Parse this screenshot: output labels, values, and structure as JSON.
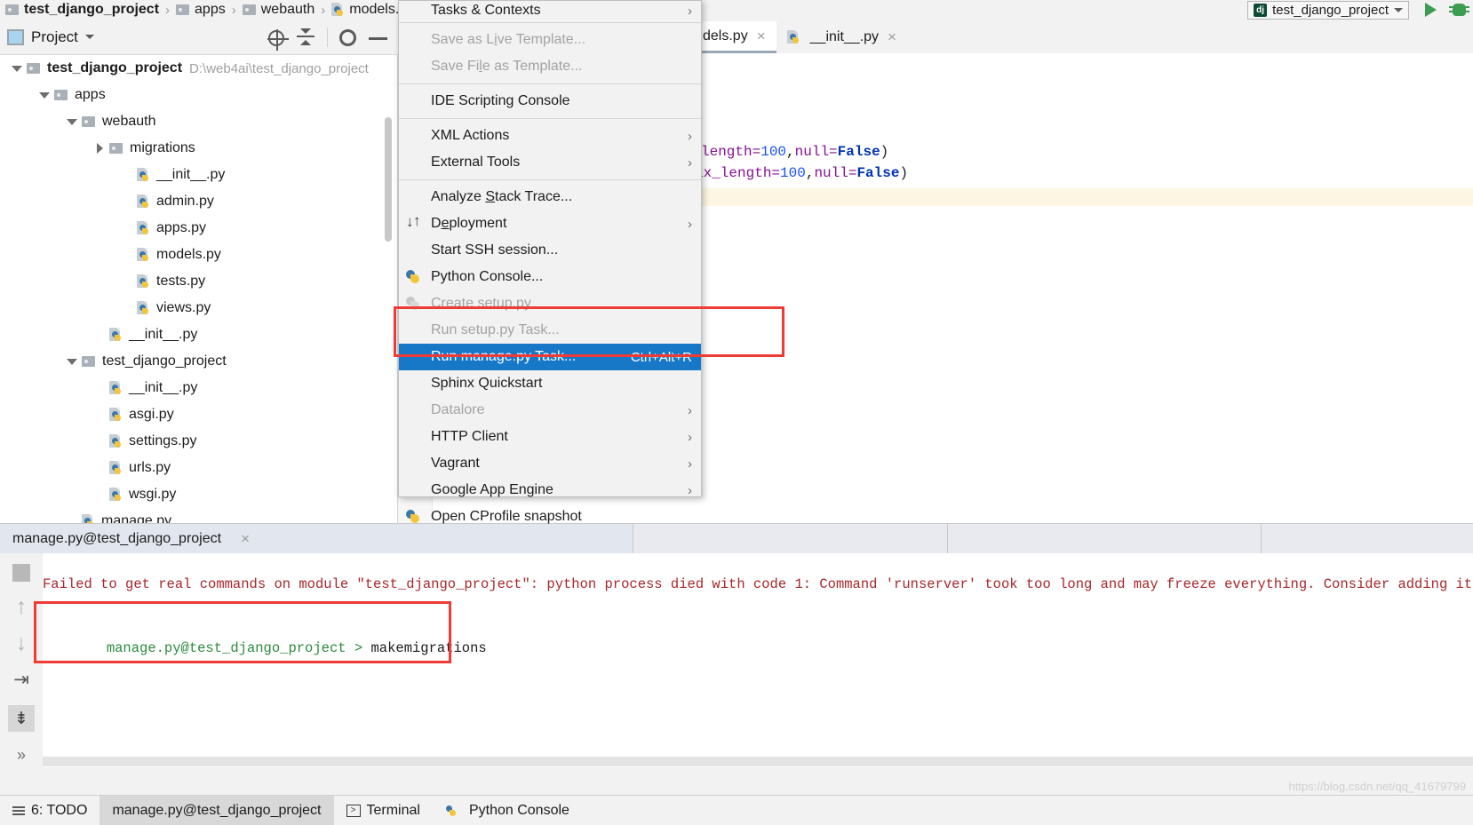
{
  "breadcrumb": {
    "items": [
      {
        "label": "test_django_project",
        "icon": "folder-icon",
        "bold": true
      },
      {
        "label": "apps",
        "icon": "folder-icon",
        "bold": false
      },
      {
        "label": "webauth",
        "icon": "folder-icon",
        "bold": false
      },
      {
        "label": "models.py",
        "icon": "python-file-icon",
        "bold": false
      }
    ],
    "separator": "›"
  },
  "run_config": {
    "name": "test_django_project",
    "icon": "django-icon",
    "badge": "dj",
    "chevron": "chevron-down-icon",
    "run_button": "run-icon",
    "debug_button": "debug-icon"
  },
  "project_panel": {
    "title": "Project",
    "chevron": "chevron-down-icon",
    "toolbar": [
      "locate-icon",
      "collapse-all-icon",
      "settings-gear-icon",
      "minimize-icon"
    ],
    "tree": [
      {
        "label": "test_django_project",
        "path": "D:\\web4ai\\test_django_project",
        "depth": 0,
        "arrow": "down",
        "icon": "folder-icon",
        "bold": true
      },
      {
        "label": "apps",
        "path": "",
        "depth": 1,
        "arrow": "down",
        "icon": "folder-icon",
        "bold": false
      },
      {
        "label": "webauth",
        "path": "",
        "depth": 2,
        "arrow": "down",
        "icon": "folder-icon",
        "bold": false
      },
      {
        "label": "migrations",
        "path": "",
        "depth": 3,
        "arrow": "right",
        "icon": "folder-icon",
        "bold": false
      },
      {
        "label": "__init__.py",
        "path": "",
        "depth": 4,
        "arrow": "none",
        "icon": "python-file-icon",
        "bold": false
      },
      {
        "label": "admin.py",
        "path": "",
        "depth": 4,
        "arrow": "none",
        "icon": "python-file-icon",
        "bold": false
      },
      {
        "label": "apps.py",
        "path": "",
        "depth": 4,
        "arrow": "none",
        "icon": "python-file-icon",
        "bold": false
      },
      {
        "label": "models.py",
        "path": "",
        "depth": 4,
        "arrow": "none",
        "icon": "python-file-icon",
        "bold": false
      },
      {
        "label": "tests.py",
        "path": "",
        "depth": 4,
        "arrow": "none",
        "icon": "python-file-icon",
        "bold": false
      },
      {
        "label": "views.py",
        "path": "",
        "depth": 4,
        "arrow": "none",
        "icon": "python-file-icon",
        "bold": false
      },
      {
        "label": "__init__.py",
        "path": "",
        "depth": 3,
        "arrow": "none",
        "icon": "python-file-icon",
        "bold": false
      },
      {
        "label": "test_django_project",
        "path": "",
        "depth": 2,
        "arrow": "down",
        "icon": "folder-icon",
        "bold": false
      },
      {
        "label": "__init__.py",
        "path": "",
        "depth": 3,
        "arrow": "none",
        "icon": "python-file-icon",
        "bold": false
      },
      {
        "label": "asgi.py",
        "path": "",
        "depth": 3,
        "arrow": "none",
        "icon": "python-file-icon",
        "bold": false
      },
      {
        "label": "settings.py",
        "path": "",
        "depth": 3,
        "arrow": "none",
        "icon": "python-file-icon",
        "bold": false
      },
      {
        "label": "urls.py",
        "path": "",
        "depth": 3,
        "arrow": "none",
        "icon": "python-file-icon",
        "bold": false
      },
      {
        "label": "wsgi.py",
        "path": "",
        "depth": 3,
        "arrow": "none",
        "icon": "python-file-icon",
        "bold": false
      },
      {
        "label": "manage.py",
        "path": "",
        "depth": 2,
        "arrow": "none",
        "icon": "python-file-icon",
        "bold": false
      }
    ]
  },
  "editor": {
    "tabs": [
      {
        "label": "dels.py",
        "icon": "python-file-icon",
        "active": true,
        "close": "×"
      },
      {
        "label": "__init__.py",
        "icon": "python-file-icon",
        "active": false,
        "close": "×"
      }
    ],
    "code": [
      {
        "parts": [
          {
            "text": "length=",
            "cls": "k-purple"
          },
          {
            "text": "100",
            "cls": "k-num"
          },
          {
            "text": ",",
            "cls": "k-plain"
          },
          {
            "text": "null=",
            "cls": "k-purple"
          },
          {
            "text": "False",
            "cls": "k-kw"
          },
          {
            "text": ")",
            "cls": "k-plain"
          }
        ]
      },
      {
        "parts": [
          {
            "text": "ax_length=",
            "cls": "k-purple"
          },
          {
            "text": "100",
            "cls": "k-num"
          },
          {
            "text": ",",
            "cls": "k-plain"
          },
          {
            "text": "null=",
            "cls": "k-purple"
          },
          {
            "text": "False",
            "cls": "k-kw"
          },
          {
            "text": ")",
            "cls": "k-plain"
          }
        ]
      }
    ]
  },
  "context_menu": {
    "items": [
      {
        "label": "Tasks & Contexts",
        "state": "normal",
        "submenu": true,
        "clipped": true,
        "icon": ""
      },
      {
        "sep": true
      },
      {
        "label": "Save as Live Template...",
        "state": "disabled",
        "accel": "i",
        "icon": ""
      },
      {
        "label": "Save File as Template...",
        "state": "disabled",
        "accel": "l",
        "icon": ""
      },
      {
        "sep": true
      },
      {
        "label": "IDE Scripting Console",
        "state": "normal",
        "icon": ""
      },
      {
        "sep": true
      },
      {
        "label": "XML Actions",
        "state": "normal",
        "submenu": true,
        "icon": ""
      },
      {
        "label": "External Tools",
        "state": "normal",
        "submenu": true,
        "icon": ""
      },
      {
        "sep": true
      },
      {
        "label": "Analyze Stack Trace...",
        "state": "normal",
        "accel": "S",
        "icon": ""
      },
      {
        "label": "Deployment",
        "state": "normal",
        "submenu": true,
        "accel": "e",
        "icon": "deployment-icon"
      },
      {
        "label": "Start SSH session...",
        "state": "normal",
        "icon": ""
      },
      {
        "label": "Python Console...",
        "state": "normal",
        "icon": "python-console-icon"
      },
      {
        "label": "Create setup.py",
        "state": "disabled",
        "icon": "python-file-icon-gray"
      },
      {
        "label": "Run setup.py Task...",
        "state": "disabled",
        "icon": ""
      },
      {
        "label": "Run manage.py Task...",
        "state": "selected",
        "shortcut": "Ctrl+Alt+R",
        "icon": ""
      },
      {
        "label": "Sphinx Quickstart",
        "state": "normal",
        "icon": ""
      },
      {
        "label": "Datalore",
        "state": "disabled",
        "submenu": true,
        "icon": ""
      },
      {
        "label": "HTTP Client",
        "state": "normal",
        "submenu": true,
        "icon": ""
      },
      {
        "label": "Vagrant",
        "state": "normal",
        "submenu": true,
        "icon": ""
      },
      {
        "label": "Google App Engine",
        "state": "normal",
        "submenu": true,
        "icon": ""
      },
      {
        "label": "Open CProfile snapshot",
        "state": "normal",
        "icon": "cprofile-icon"
      }
    ],
    "submenu_arrow": "›"
  },
  "run_window": {
    "tab_label": "manage.py@test_django_project",
    "tab_close": "×",
    "side_icons": [
      "stop-icon",
      "scroll-up-icon",
      "scroll-down-icon",
      "soft-wrap-icon",
      "scroll-to-end-icon",
      "expand-icon"
    ],
    "console": {
      "error_line": "Failed to get real commands on module \"test_django_project\": python process died with code 1: Command 'runserver' took too long and may freeze everything. Consider adding it to '",
      "prompt": "manage.py@test_django_project >",
      "command": "makemigrations"
    }
  },
  "statusbar": {
    "items": [
      {
        "label": "6: TODO",
        "icon": "todo-icon",
        "active": false
      },
      {
        "label": "manage.py@test_django_project",
        "icon": "",
        "active": true
      },
      {
        "label": "Terminal",
        "icon": "terminal-icon",
        "active": false
      },
      {
        "label": "Python Console",
        "icon": "python-console-icon",
        "active": false
      }
    ]
  },
  "watermark": "https://blog.csdn.net/qq_41679799",
  "colors": {
    "selection": "#1878c8",
    "annotation": "#ef3b36",
    "error_text": "#a8262b",
    "prompt_green": "#2b8a3e",
    "keyword": "#0033b3",
    "number": "#1750eb",
    "attribute": "#871094"
  }
}
